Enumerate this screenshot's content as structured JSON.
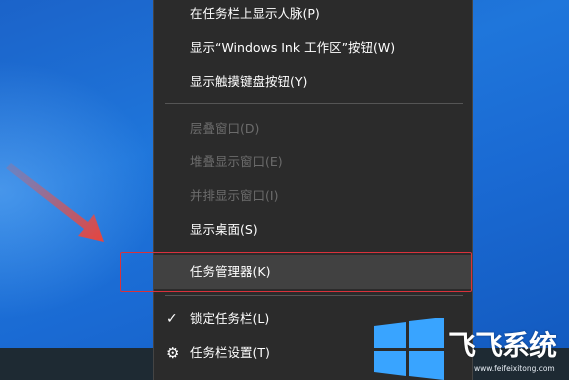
{
  "menu": {
    "items": [
      {
        "label": "在任务栏上显示人脉(P)",
        "enabled": true
      },
      {
        "label": "显示“Windows Ink 工作区”按钮(W)",
        "enabled": true
      },
      {
        "label": "显示触摸键盘按钮(Y)",
        "enabled": true
      },
      {
        "label": "层叠窗口(D)",
        "enabled": false
      },
      {
        "label": "堆叠显示窗口(E)",
        "enabled": false
      },
      {
        "label": "并排显示窗口(I)",
        "enabled": false
      },
      {
        "label": "显示桌面(S)",
        "enabled": true
      },
      {
        "label": "任务管理器(K)",
        "enabled": true,
        "highlighted": true
      },
      {
        "label": "锁定任务栏(L)",
        "enabled": true,
        "checked": true
      },
      {
        "label": "任务栏设置(T)",
        "enabled": true,
        "icon": "gear-icon"
      }
    ]
  },
  "watermark": {
    "brand": "飞飞系统",
    "url": "www.feifeixitong.com"
  },
  "colors": {
    "menu_bg": "#2b2b2b",
    "hover_bg": "#414141",
    "highlight_border": "#d9323b",
    "arrow": "#e8453c",
    "desktop": "#1f76db"
  }
}
